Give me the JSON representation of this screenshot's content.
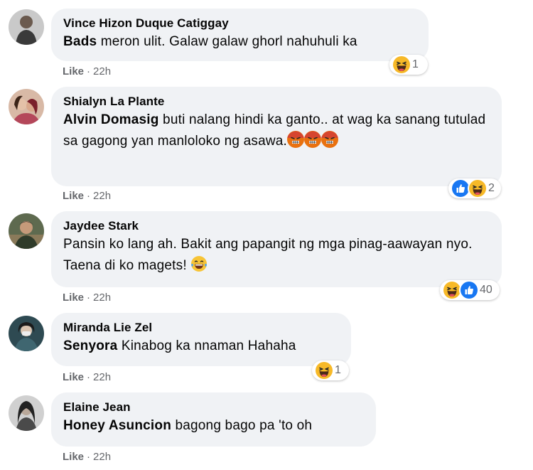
{
  "comments": [
    {
      "author": "Vince Hizon Duque Catiggay",
      "mention": "Bads",
      "text": " meron ulit. Galaw galaw ghorl nahuhuli ka",
      "like_label": "Like",
      "time": "22h",
      "reaction_count": "1",
      "reaction_icons": [
        "haha-icon"
      ]
    },
    {
      "author": "Shialyn La Plante",
      "mention": "Alvin Domasig",
      "text": " buti nalang hindi ka ganto.. at wag ka sanang tutulad sa gagong yan manloloko ng asawa.",
      "like_label": "Like",
      "time": "22h",
      "reaction_count": "2",
      "reaction_icons": [
        "like-icon",
        "haha-icon"
      ]
    },
    {
      "author": "Jaydee Stark",
      "text": "Pansin ko lang ah. Bakit ang papangit ng mga pinag-aawayan nyo. Taena di ko magets!",
      "like_label": "Like",
      "time": "22h",
      "reaction_count": "40",
      "reaction_icons": [
        "haha-icon",
        "like-icon"
      ]
    },
    {
      "author": "Miranda Lie Zel",
      "mention": "Senyora",
      "text": " Kinabog ka nnaman Hahaha",
      "like_label": "Like",
      "time": "22h",
      "reaction_count": "1",
      "reaction_icons": [
        "haha-icon"
      ]
    },
    {
      "author": "Elaine Jean",
      "mention": "Honey Asuncion",
      "text": " bagong bago pa 'to oh",
      "like_label": "Like",
      "time": "22h"
    }
  ],
  "colors": {
    "bubble": "#f0f2f5",
    "meta": "#65676b",
    "like_blue": "#1877f2",
    "haha_yellow": "#f7b928"
  }
}
